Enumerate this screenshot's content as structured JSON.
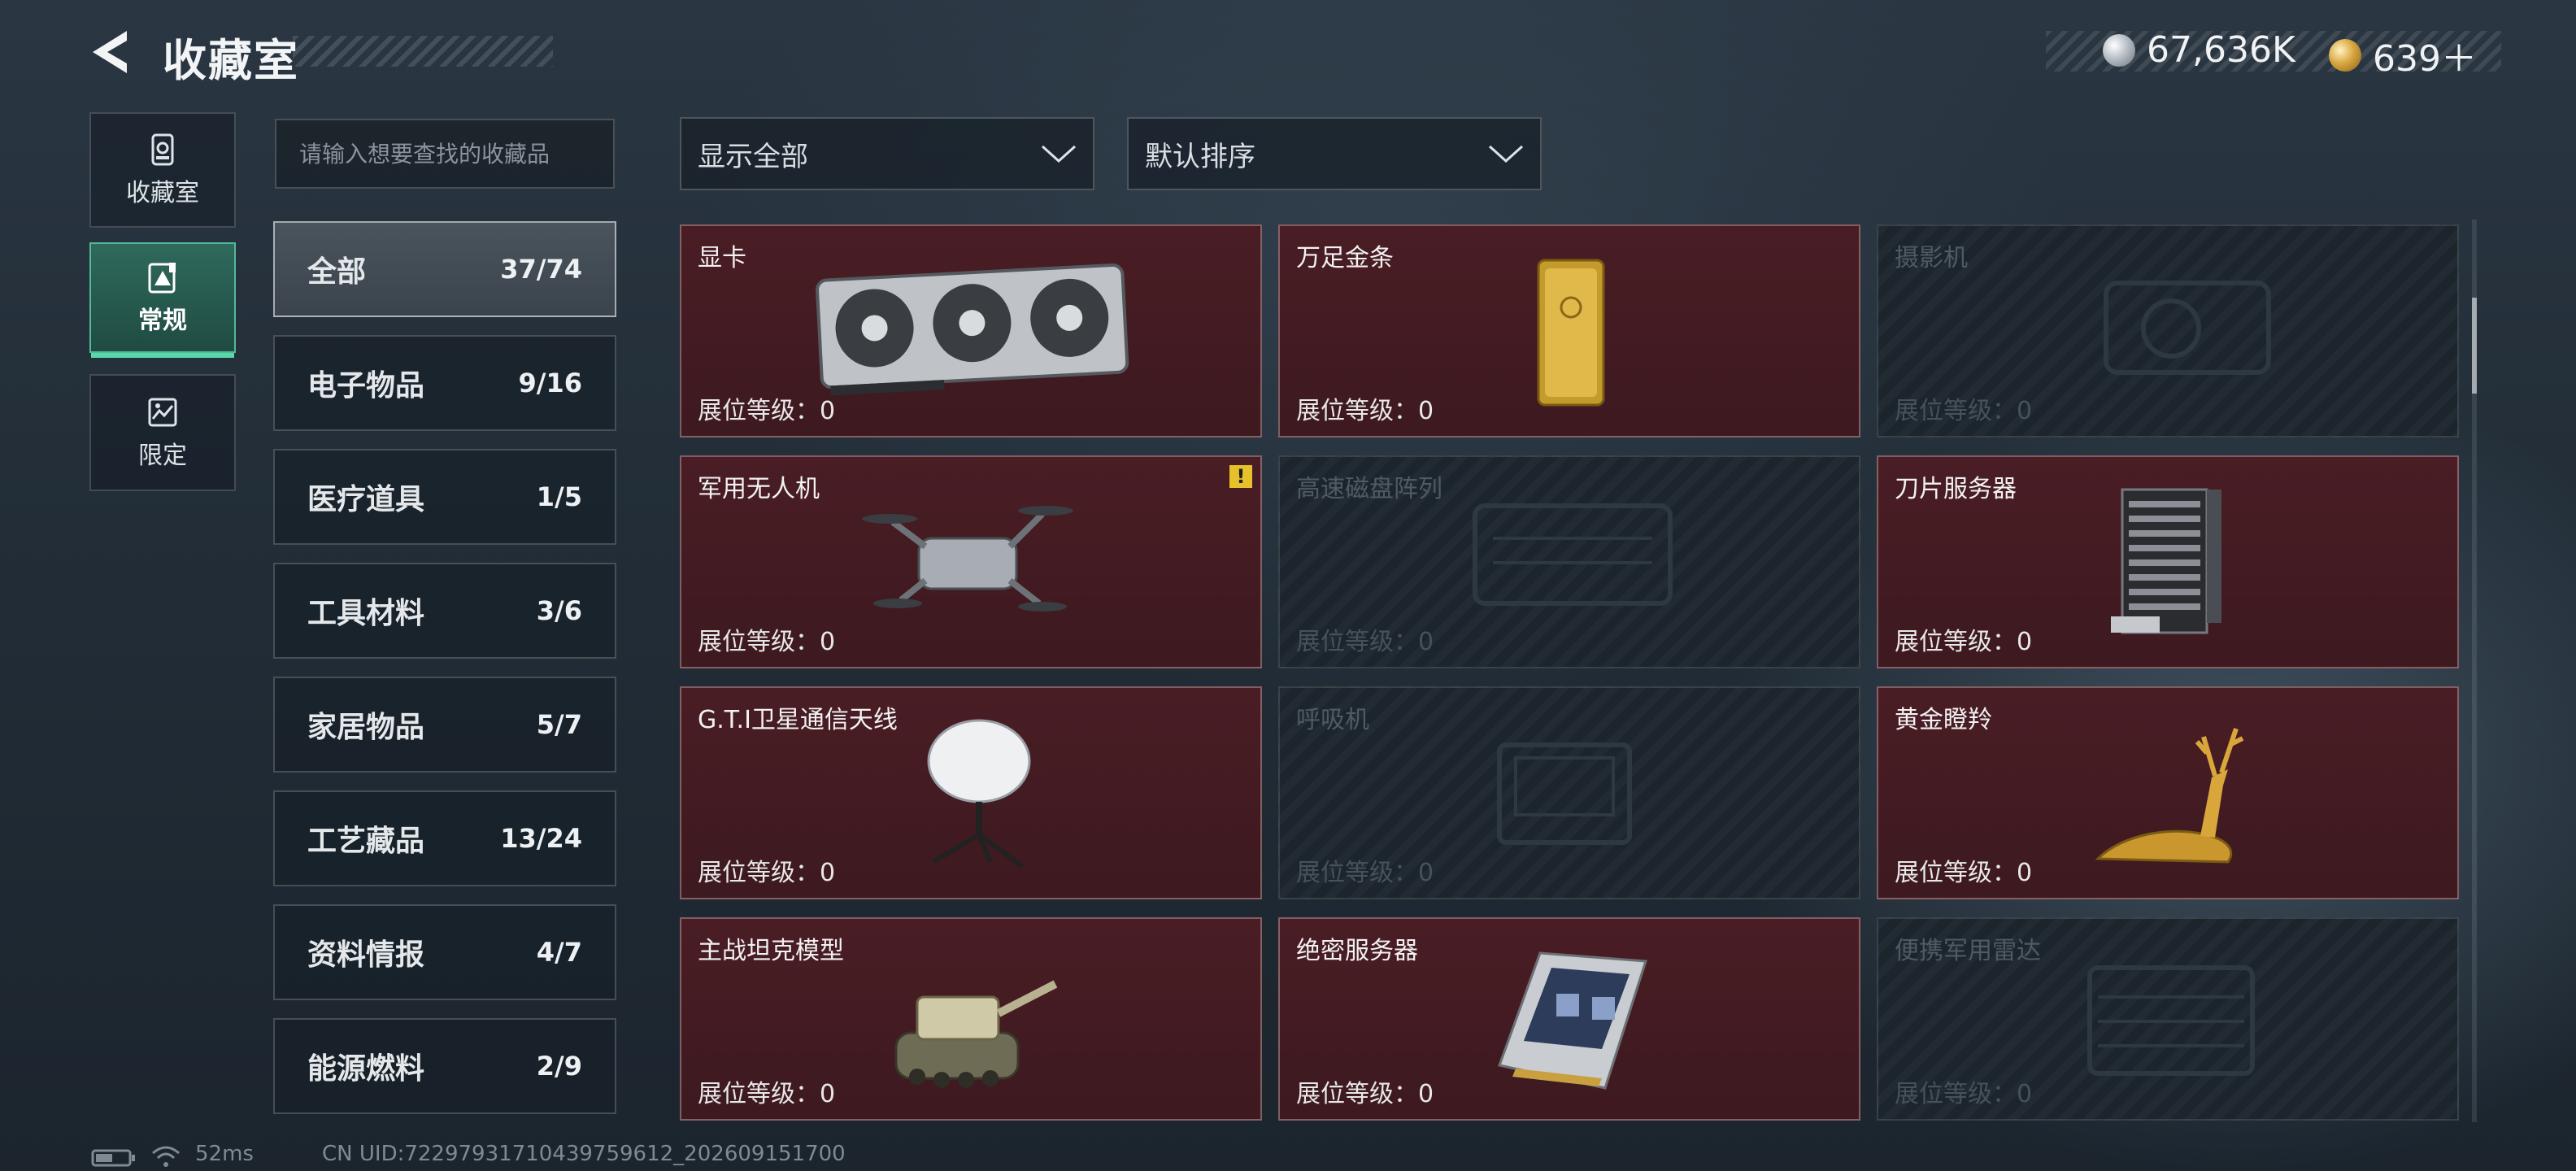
{
  "header": {
    "title": "收藏室"
  },
  "currency": [
    {
      "icon": "silver-coin-icon",
      "value": "67,636K"
    },
    {
      "icon": "gold-coin-icon",
      "value": "639＋"
    }
  ],
  "rail": [
    {
      "label": "收藏室",
      "icon": "collection-icon",
      "active": false
    },
    {
      "label": "常规",
      "icon": "regular-icon",
      "active": true
    },
    {
      "label": "限定",
      "icon": "limited-icon",
      "active": false
    }
  ],
  "search": {
    "placeholder": "请输入想要查找的收藏品"
  },
  "filters": {
    "show": "显示全部",
    "sort": "默认排序"
  },
  "categories": [
    {
      "name": "全部",
      "count": "37/74"
    },
    {
      "name": "电子物品",
      "count": "9/16"
    },
    {
      "name": "医疗道具",
      "count": "1/5"
    },
    {
      "name": "工具材料",
      "count": "3/6"
    },
    {
      "name": "家居物品",
      "count": "5/7"
    },
    {
      "name": "工艺藏品",
      "count": "13/24"
    },
    {
      "name": "资料情报",
      "count": "4/7"
    },
    {
      "name": "能源燃料",
      "count": "2/9"
    }
  ],
  "items": [
    {
      "name": "显卡",
      "level": "展位等级：0",
      "owned": true,
      "art": "gpu-icon"
    },
    {
      "name": "万足金条",
      "level": "展位等级：0",
      "owned": true,
      "art": "gold-bar-icon"
    },
    {
      "name": "摄影机",
      "level": "展位等级：0",
      "owned": false,
      "art": "camera-icon"
    },
    {
      "name": "军用无人机",
      "level": "展位等级：0",
      "owned": true,
      "art": "drone-icon",
      "alert": "!"
    },
    {
      "name": "高速磁盘阵列",
      "level": "展位等级：0",
      "owned": false,
      "art": "disk-array-icon"
    },
    {
      "name": "刀片服务器",
      "level": "展位等级：0",
      "owned": true,
      "art": "blade-server-icon"
    },
    {
      "name": "G.T.I卫星通信天线",
      "level": "展位等级：0",
      "owned": true,
      "art": "satellite-dish-icon"
    },
    {
      "name": "呼吸机",
      "level": "展位等级：0",
      "owned": false,
      "art": "ventilator-icon"
    },
    {
      "name": "黄金瞪羚",
      "level": "展位等级：0",
      "owned": true,
      "art": "golden-gazelle-icon"
    },
    {
      "name": "主战坦克模型",
      "level": "展位等级：0",
      "owned": true,
      "art": "tank-model-icon"
    },
    {
      "name": "绝密服务器",
      "level": "展位等级：0",
      "owned": true,
      "art": "server-icon"
    },
    {
      "name": "便携军用雷达",
      "level": "展位等级：0",
      "owned": false,
      "art": "radar-icon"
    }
  ],
  "footer": {
    "ping": "52ms",
    "uid": "CN UID:72297931710439759612_202609151700"
  }
}
